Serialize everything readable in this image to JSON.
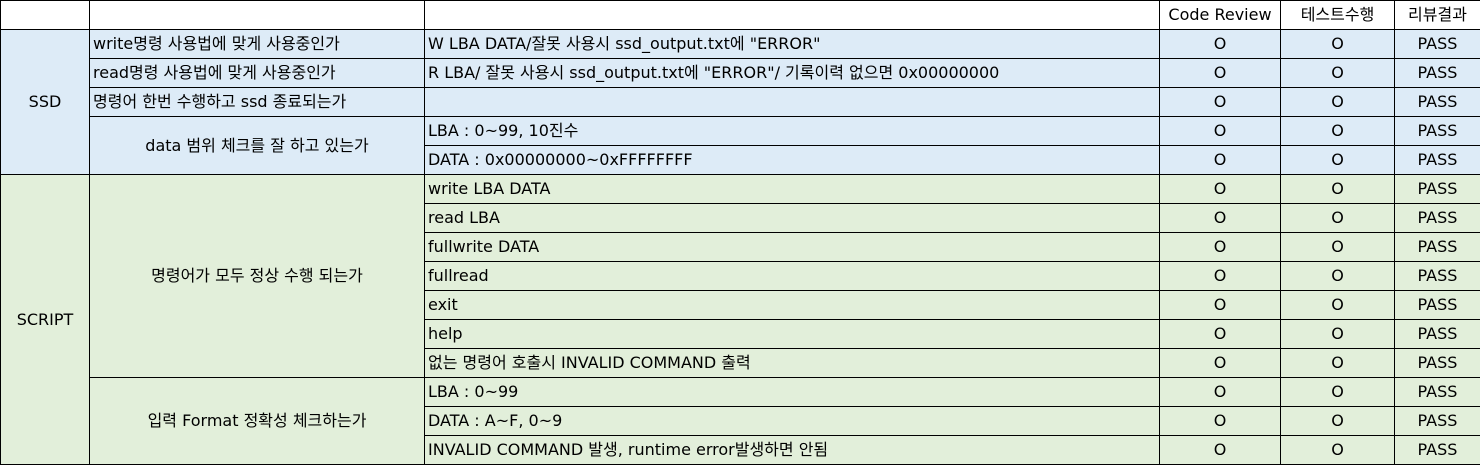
{
  "headers": {
    "category": "",
    "item": "",
    "detail": "",
    "code_review": "Code Review",
    "test_run": "테스트수행",
    "review_result": "리뷰결과"
  },
  "ssd": {
    "category": "SSD",
    "rows": [
      {
        "item": "write명령 사용법에 맞게 사용중인가",
        "detail": "W LBA DATA/잘못 사용시 ssd_output.txt에  \"ERROR\"",
        "code_review": "O",
        "test_run": "O",
        "result": "PASS"
      },
      {
        "item": "read명령 사용법에 맞게 사용중인가",
        "detail": "R LBA/ 잘못 사용시 ssd_output.txt에 \"ERROR\"/ 기록이력 없으면 0x00000000",
        "code_review": "O",
        "test_run": "O",
        "result": "PASS"
      },
      {
        "item": "명령어 한번 수행하고 ssd 종료되는가",
        "detail": "",
        "code_review": "O",
        "test_run": "O",
        "result": "PASS"
      }
    ],
    "range_group": {
      "item": "data 범위 체크를 잘 하고 있는가",
      "rows": [
        {
          "detail": "LBA : 0~99, 10진수",
          "code_review": "O",
          "test_run": "O",
          "result": "PASS"
        },
        {
          "detail": "DATA : 0x00000000~0xFFFFFFFF",
          "code_review": "O",
          "test_run": "O",
          "result": "PASS"
        }
      ]
    }
  },
  "script": {
    "category": "SCRIPT",
    "command_group": {
      "item": "명령어가 모두 정상 수행 되는가",
      "rows": [
        {
          "detail": "write LBA DATA",
          "code_review": "O",
          "test_run": "O",
          "result": "PASS"
        },
        {
          "detail": "read LBA",
          "code_review": "O",
          "test_run": "O",
          "result": "PASS"
        },
        {
          "detail": "fullwrite DATA",
          "code_review": "O",
          "test_run": "O",
          "result": "PASS"
        },
        {
          "detail": "fullread",
          "code_review": "O",
          "test_run": "O",
          "result": "PASS"
        },
        {
          "detail": "exit",
          "code_review": "O",
          "test_run": "O",
          "result": "PASS"
        },
        {
          "detail": "help",
          "code_review": "O",
          "test_run": "O",
          "result": "PASS"
        },
        {
          "detail": "없는 명령어 호출시 INVALID COMMAND 출력",
          "code_review": "O",
          "test_run": "O",
          "result": "PASS"
        }
      ]
    },
    "format_group": {
      "item": "입력 Format 정확성 체크하는가",
      "rows": [
        {
          "detail": "LBA : 0~99",
          "code_review": "O",
          "test_run": "O",
          "result": "PASS"
        },
        {
          "detail": "DATA : A~F, 0~9",
          "code_review": "O",
          "test_run": "O",
          "result": "PASS"
        },
        {
          "detail": "INVALID COMMAND 발생, runtime error발생하면 안됨",
          "code_review": "O",
          "test_run": "O",
          "result": "PASS"
        }
      ]
    }
  }
}
